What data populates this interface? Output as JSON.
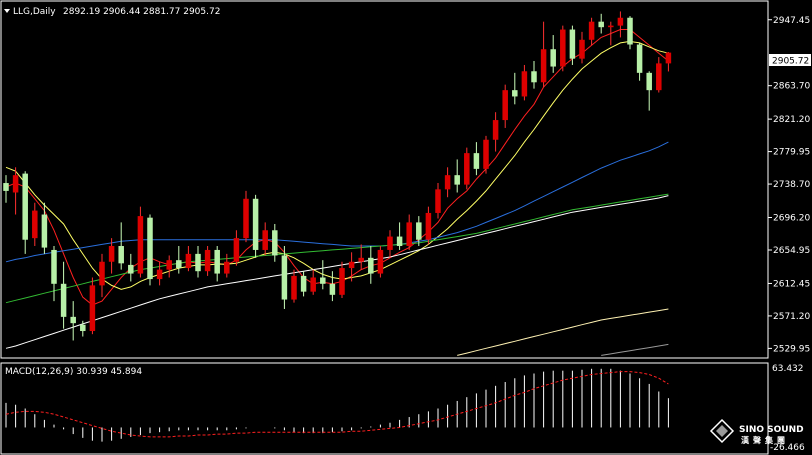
{
  "chart_data": [
    {
      "type": "candlestick",
      "symbol_label": "LLG,Daily",
      "ohlc_readout": "2892.19 2906.44 2881.77 2905.72",
      "last_price_label": "2905.72",
      "ylim": [
        2519,
        2970
      ],
      "y_ticks": [
        2947.45,
        2905.72,
        2863.7,
        2821.2,
        2779.95,
        2738.7,
        2696.2,
        2654.95,
        2612.45,
        2571.2,
        2529.95
      ],
      "y_tick_labels": [
        "2947.45",
        "2905.72",
        "2863.70",
        "2821.20",
        "2779.95",
        "2738.70",
        "2696.20",
        "2654.95",
        "2612.45",
        "2571.20",
        "2529.95"
      ],
      "candles": [
        [
          2740,
          2750,
          2715,
          2730
        ],
        [
          2728,
          2760,
          2700,
          2750
        ],
        [
          2752,
          2755,
          2650,
          2668
        ],
        [
          2670,
          2715,
          2660,
          2705
        ],
        [
          2700,
          2715,
          2650,
          2658
        ],
        [
          2655,
          2660,
          2590,
          2612
        ],
        [
          2612,
          2640,
          2555,
          2570
        ],
        [
          2570,
          2590,
          2540,
          2562
        ],
        [
          2560,
          2565,
          2545,
          2552
        ],
        [
          2552,
          2620,
          2548,
          2610
        ],
        [
          2610,
          2650,
          2595,
          2640
        ],
        [
          2640,
          2670,
          2625,
          2660
        ],
        [
          2660,
          2690,
          2630,
          2638
        ],
        [
          2636,
          2650,
          2615,
          2625
        ],
        [
          2625,
          2710,
          2620,
          2698
        ],
        [
          2696,
          2700,
          2610,
          2618
        ],
        [
          2618,
          2640,
          2610,
          2630
        ],
        [
          2630,
          2648,
          2620,
          2642
        ],
        [
          2642,
          2660,
          2625,
          2632
        ],
        [
          2632,
          2660,
          2628,
          2650
        ],
        [
          2650,
          2660,
          2620,
          2628
        ],
        [
          2628,
          2660,
          2622,
          2655
        ],
        [
          2655,
          2660,
          2615,
          2625
        ],
        [
          2625,
          2650,
          2620,
          2640
        ],
        [
          2640,
          2680,
          2635,
          2670
        ],
        [
          2670,
          2730,
          2665,
          2720
        ],
        [
          2720,
          2725,
          2645,
          2655
        ],
        [
          2655,
          2690,
          2648,
          2680
        ],
        [
          2680,
          2688,
          2640,
          2648
        ],
        [
          2648,
          2660,
          2580,
          2592
        ],
        [
          2592,
          2630,
          2588,
          2622
        ],
        [
          2622,
          2628,
          2596,
          2602
        ],
        [
          2602,
          2630,
          2598,
          2620
        ],
        [
          2620,
          2642,
          2605,
          2612
        ],
        [
          2612,
          2628,
          2590,
          2598
        ],
        [
          2598,
          2640,
          2594,
          2632
        ],
        [
          2632,
          2652,
          2615,
          2640
        ],
        [
          2640,
          2662,
          2630,
          2645
        ],
        [
          2645,
          2660,
          2612,
          2625
        ],
        [
          2625,
          2660,
          2620,
          2655
        ],
        [
          2655,
          2680,
          2645,
          2672
        ],
        [
          2672,
          2690,
          2655,
          2660
        ],
        [
          2660,
          2700,
          2655,
          2690
        ],
        [
          2690,
          2698,
          2660,
          2668
        ],
        [
          2668,
          2710,
          2662,
          2702
        ],
        [
          2702,
          2740,
          2695,
          2732
        ],
        [
          2732,
          2760,
          2722,
          2750
        ],
        [
          2750,
          2770,
          2728,
          2738
        ],
        [
          2738,
          2785,
          2732,
          2778
        ],
        [
          2778,
          2792,
          2750,
          2758
        ],
        [
          2758,
          2800,
          2752,
          2795
        ],
        [
          2795,
          2830,
          2780,
          2820
        ],
        [
          2820,
          2865,
          2810,
          2858
        ],
        [
          2858,
          2880,
          2840,
          2850
        ],
        [
          2850,
          2890,
          2845,
          2882
        ],
        [
          2882,
          2895,
          2860,
          2868
        ],
        [
          2868,
          2945,
          2862,
          2910
        ],
        [
          2910,
          2928,
          2880,
          2888
        ],
        [
          2888,
          2940,
          2882,
          2935
        ],
        [
          2935,
          2940,
          2890,
          2898
        ],
        [
          2898,
          2932,
          2892,
          2922
        ],
        [
          2922,
          2950,
          2915,
          2945
        ],
        [
          2945,
          2955,
          2930,
          2938
        ],
        [
          2938,
          2945,
          2915,
          2940
        ],
        [
          2940,
          2958,
          2925,
          2950
        ],
        [
          2950,
          2952,
          2910,
          2916
        ],
        [
          2916,
          2918,
          2870,
          2880
        ],
        [
          2880,
          2882,
          2832,
          2858
        ],
        [
          2858,
          2900,
          2855,
          2892
        ],
        [
          2892,
          2906.44,
          2881.77,
          2905.72
        ]
      ],
      "ma_lines": [
        {
          "color": "#ff2020",
          "values": [
            2735,
            2740,
            2735,
            2720,
            2705,
            2680,
            2650,
            2620,
            2595,
            2585,
            2590,
            2605,
            2620,
            2632,
            2640,
            2645,
            2640,
            2636,
            2638,
            2640,
            2638,
            2640,
            2638,
            2636,
            2642,
            2655,
            2665,
            2668,
            2665,
            2652,
            2635,
            2620,
            2612,
            2614,
            2612,
            2615,
            2622,
            2630,
            2635,
            2638,
            2645,
            2652,
            2658,
            2668,
            2678,
            2690,
            2708,
            2720,
            2730,
            2745,
            2758,
            2772,
            2790,
            2808,
            2825,
            2840,
            2862,
            2875,
            2888,
            2898,
            2905,
            2915,
            2925,
            2930,
            2935,
            2935,
            2925,
            2915,
            2905,
            2895
          ]
        },
        {
          "color": "#ffff66",
          "values": [
            2760,
            2755,
            2740,
            2725,
            2712,
            2700,
            2688,
            2668,
            2650,
            2632,
            2618,
            2610,
            2605,
            2608,
            2615,
            2620,
            2624,
            2628,
            2632,
            2634,
            2636,
            2636,
            2637,
            2637,
            2638,
            2642,
            2646,
            2650,
            2652,
            2650,
            2645,
            2638,
            2630,
            2624,
            2620,
            2618,
            2620,
            2622,
            2626,
            2630,
            2636,
            2642,
            2648,
            2654,
            2662,
            2672,
            2682,
            2694,
            2705,
            2717,
            2730,
            2745,
            2760,
            2775,
            2792,
            2808,
            2825,
            2842,
            2858,
            2872,
            2885,
            2895,
            2905,
            2912,
            2918,
            2920,
            2918,
            2913,
            2908,
            2905
          ]
        },
        {
          "color": "#2a6fdd",
          "values": [
            2640,
            2643,
            2645,
            2648,
            2650,
            2652,
            2654,
            2656,
            2658,
            2660,
            2662,
            2664,
            2666,
            2667,
            2668,
            2668,
            2668,
            2668,
            2668,
            2668,
            2668,
            2668,
            2668,
            2668,
            2668,
            2668,
            2668,
            2668,
            2668,
            2667,
            2666,
            2665,
            2664,
            2663,
            2662,
            2661,
            2660,
            2660,
            2660,
            2660,
            2661,
            2662,
            2664,
            2666,
            2668,
            2671,
            2674,
            2677,
            2681,
            2685,
            2690,
            2695,
            2700,
            2705,
            2711,
            2717,
            2723,
            2729,
            2735,
            2741,
            2747,
            2753,
            2759,
            2764,
            2769,
            2773,
            2777,
            2781,
            2786,
            2792
          ]
        },
        {
          "color": "#33bb33",
          "values": [
            2588,
            2591,
            2594,
            2597,
            2600,
            2603,
            2606,
            2609,
            2612,
            2615,
            2618,
            2621,
            2624,
            2627,
            2630,
            2632,
            2634,
            2636,
            2638,
            2640,
            2641,
            2642,
            2643,
            2644,
            2645,
            2646,
            2647,
            2648,
            2649,
            2650,
            2651,
            2652,
            2653,
            2654,
            2655,
            2656,
            2657,
            2658,
            2659,
            2660,
            2661,
            2662,
            2663,
            2664,
            2666,
            2668,
            2670,
            2672,
            2674,
            2676,
            2679,
            2682,
            2685,
            2688,
            2691,
            2694,
            2697,
            2700,
            2703,
            2706,
            2708,
            2710,
            2712,
            2714,
            2716,
            2718,
            2720,
            2722,
            2724,
            2726
          ]
        },
        {
          "color": "#ffffff",
          "values": [
            2530,
            2533,
            2537,
            2541,
            2545,
            2549,
            2553,
            2557,
            2561,
            2565,
            2569,
            2573,
            2577,
            2581,
            2585,
            2589,
            2593,
            2596,
            2599,
            2602,
            2605,
            2608,
            2610,
            2612,
            2614,
            2616,
            2618,
            2620,
            2622,
            2624,
            2626,
            2628,
            2630,
            2632,
            2634,
            2636,
            2638,
            2640,
            2642,
            2644,
            2646,
            2649,
            2652,
            2655,
            2658,
            2661,
            2664,
            2667,
            2670,
            2673,
            2676,
            2679,
            2682,
            2685,
            2688,
            2691,
            2694,
            2697,
            2700,
            2703,
            2705,
            2707,
            2709,
            2711,
            2713,
            2715,
            2717,
            2719,
            2721,
            2724
          ]
        },
        {
          "color": "#fff2b3",
          "start_index": 47,
          "values": [
            2521,
            2524,
            2527,
            2530,
            2533,
            2536,
            2539,
            2542,
            2545,
            2548,
            2551,
            2554,
            2557,
            2560,
            2563,
            2566,
            2568,
            2570,
            2572,
            2574,
            2576,
            2578,
            2580
          ]
        },
        {
          "color": "#999999",
          "start_index": 62,
          "values": [
            2521,
            2523,
            2525,
            2527,
            2529,
            2531,
            2533,
            2535
          ]
        }
      ]
    },
    {
      "type": "bar",
      "indicator_label": "MACD(12,26,9) 30.939 45.894",
      "ylim": [
        -27,
        66
      ],
      "y_tick_labels": [
        "63.432",
        "-26.466"
      ],
      "histogram_color": "#ffffff",
      "signal_color": "#ff2020",
      "histogram": [
        26,
        24,
        20,
        14,
        8,
        3,
        -2,
        -7,
        -11,
        -14,
        -15,
        -14,
        -12,
        -10,
        -8,
        -6,
        -5,
        -4,
        -3,
        -3,
        -3,
        -3,
        -3,
        -3,
        -2,
        -1,
        0,
        0,
        -1,
        -3,
        -5,
        -6,
        -6,
        -6,
        -5,
        -4,
        -3,
        -1,
        1,
        3,
        5,
        8,
        11,
        14,
        17,
        20,
        24,
        28,
        32,
        36,
        40,
        44,
        48,
        52,
        55,
        57,
        59,
        60,
        60,
        60,
        61,
        62,
        62,
        62,
        60,
        57,
        52,
        46,
        38,
        30.939
      ],
      "signal": [
        14,
        16,
        17,
        17,
        16,
        14,
        11,
        8,
        5,
        2,
        -1,
        -4,
        -6,
        -8,
        -9,
        -10,
        -10,
        -10,
        -9,
        -9,
        -8,
        -8,
        -7,
        -7,
        -6,
        -6,
        -5,
        -5,
        -5,
        -5,
        -5,
        -5,
        -5,
        -5,
        -5,
        -5,
        -4,
        -4,
        -3,
        -2,
        -1,
        0,
        2,
        4,
        6,
        8,
        11,
        14,
        17,
        20,
        23,
        26,
        30,
        34,
        37,
        41,
        44,
        47,
        50,
        52,
        54,
        56,
        57,
        58,
        59,
        59,
        58,
        56,
        52,
        45.894
      ]
    }
  ],
  "watermark": {
    "brand": "SINO SOUND",
    "subtitle": "漢聲集團"
  }
}
